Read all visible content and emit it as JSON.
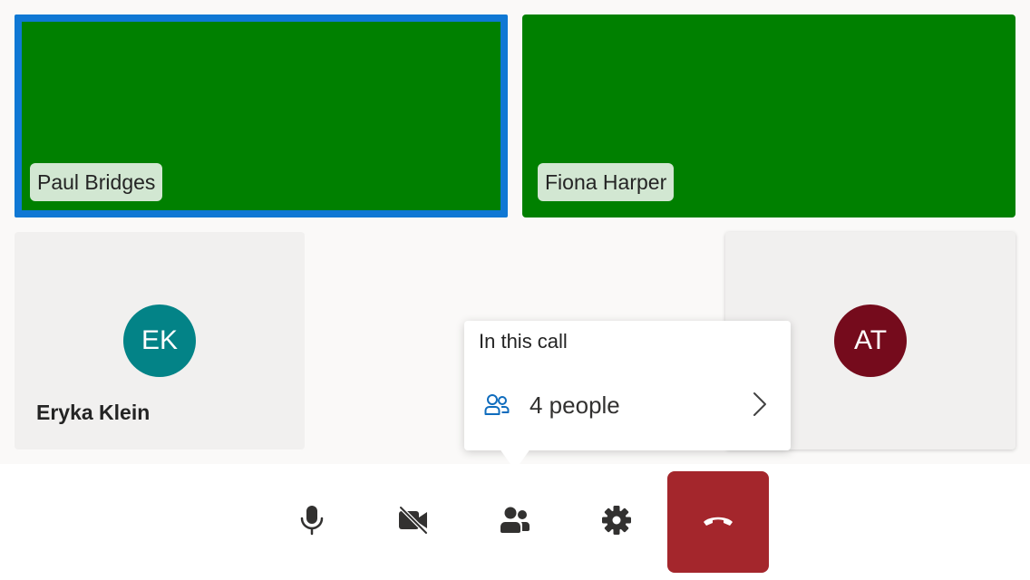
{
  "participants": [
    {
      "name": "Paul Bridges",
      "video": true,
      "active": true
    },
    {
      "name": "Fiona Harper",
      "video": true,
      "active": false
    },
    {
      "name": "Eryka Klein",
      "initials": "EK",
      "avatar_color": "#038387"
    },
    {
      "initials": "AT",
      "avatar_color": "#750b1c"
    }
  ],
  "popover": {
    "title": "In this call",
    "people_count": "4 people"
  },
  "toolbar": {
    "buttons": [
      {
        "icon": "microphone-icon"
      },
      {
        "icon": "camera-off-icon"
      },
      {
        "icon": "people-icon"
      },
      {
        "icon": "gear-icon"
      },
      {
        "icon": "hang-up-icon",
        "color": "#a4262c"
      }
    ]
  },
  "colors": {
    "video_bg": "#008000",
    "active_border": "#0f78d4",
    "label_bg": "#d2e7d2",
    "accent": "#0f6cbd"
  }
}
